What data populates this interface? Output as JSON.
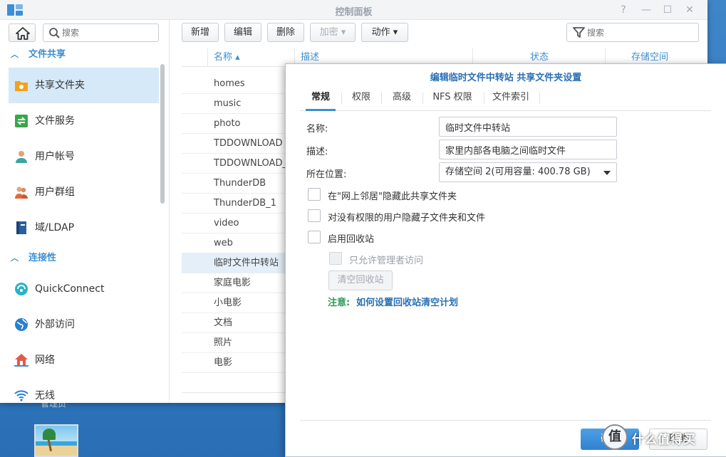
{
  "desktop": {
    "icon_label": "管理员"
  },
  "window": {
    "title": "控制面板",
    "controls": [
      "?",
      "—",
      "☐",
      "✕"
    ]
  },
  "sidebar": {
    "search_placeholder": "搜索",
    "sections": [
      {
        "label": "文件共享",
        "items": [
          {
            "label": "共享文件夹",
            "icon": "shared-folder-icon",
            "active": true
          },
          {
            "label": "文件服务",
            "icon": "file-services-icon"
          },
          {
            "label": "用户帐号",
            "icon": "user-icon"
          },
          {
            "label": "用户群组",
            "icon": "group-icon"
          },
          {
            "label": "域/LDAP",
            "icon": "domain-ldap-icon"
          }
        ]
      },
      {
        "label": "连接性",
        "items": [
          {
            "label": "QuickConnect",
            "icon": "quickconnect-icon"
          },
          {
            "label": "外部访问",
            "icon": "globe-icon"
          },
          {
            "label": "网络",
            "icon": "network-icon"
          },
          {
            "label": "无线",
            "icon": "wifi-icon"
          }
        ]
      }
    ]
  },
  "toolbar": {
    "buttons": [
      {
        "label": "新增"
      },
      {
        "label": "编辑"
      },
      {
        "label": "删除"
      },
      {
        "label": "加密 ▾",
        "disabled": true
      },
      {
        "label": "动作 ▾"
      }
    ],
    "filter_placeholder": "搜索"
  },
  "grid": {
    "columns": [
      "名称 ▴",
      "描述",
      "状态",
      "存储空间"
    ],
    "rows": [
      "homes",
      "music",
      "photo",
      "TDDOWNLOAD",
      "TDDOWNLOAD_1",
      "ThunderDB",
      "ThunderDB_1",
      "video",
      "web",
      "临时文件中转站",
      "家庭电影",
      "小电影",
      "文档",
      "照片",
      "电影"
    ],
    "selected_index": 9
  },
  "dialog": {
    "title": "编辑临时文件中转站 共享文件夹设置",
    "tabs": [
      "常规",
      "权限",
      "高级",
      "NFS 权限",
      "文件索引"
    ],
    "active_tab": 0,
    "fields": {
      "name_label": "名称:",
      "name_value": "临时文件中转站",
      "desc_label": "描述:",
      "desc_value": "家里内部各电脑之间临时文件",
      "location_label": "所在位置:",
      "location_value": "存储空间 2(可用容量: 400.78 GB)"
    },
    "checkboxes": {
      "hide_network": "在\"网上邻居\"隐藏此共享文件夹",
      "hide_subfolders": "对没有权限的用户隐藏子文件夹和文件",
      "recycle_bin": "启用回收站",
      "admin_only": "只允许管理者访问"
    },
    "empty_recycle": "清空回收站",
    "note_label": "注意:",
    "note_link": "如何设置回收站清空计划",
    "ok": "确定",
    "cancel": "取消"
  },
  "watermark": {
    "badge": "值",
    "text": "什么值得买"
  },
  "colors": {
    "accent": "#3b8fd0",
    "link": "#2a6fb5",
    "note": "#2e9b56",
    "selected_row": "#e4eff9"
  }
}
